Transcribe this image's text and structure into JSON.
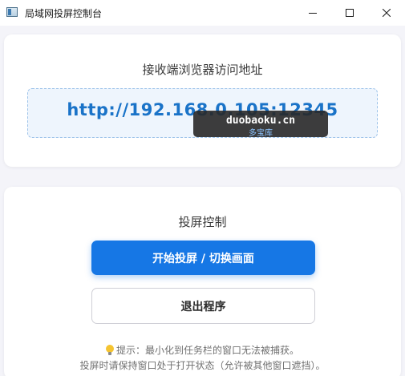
{
  "window": {
    "title": "局域网投屏控制台",
    "controls": {
      "minimize": "minimize-icon",
      "maximize": "maximize-icon",
      "close": "close-icon"
    }
  },
  "receiver": {
    "heading": "接收端浏览器访问地址",
    "url": "http://192.168.0.105:12345"
  },
  "watermark": {
    "main": "duobaoku.cn",
    "sub": "多宝库"
  },
  "control": {
    "heading": "投屏控制",
    "start_button": "开始投屏 / 切换画面",
    "exit_button": "退出程序",
    "tip_line_1": "提示：最小化到任务栏的窗口无法被捕获。",
    "tip_line_2": "投屏时请保持窗口处于打开状态（允许被其他窗口遮挡）。"
  },
  "colors": {
    "accent": "#1677e5",
    "url_text": "#1a73c8",
    "background": "#f4f4f9"
  }
}
